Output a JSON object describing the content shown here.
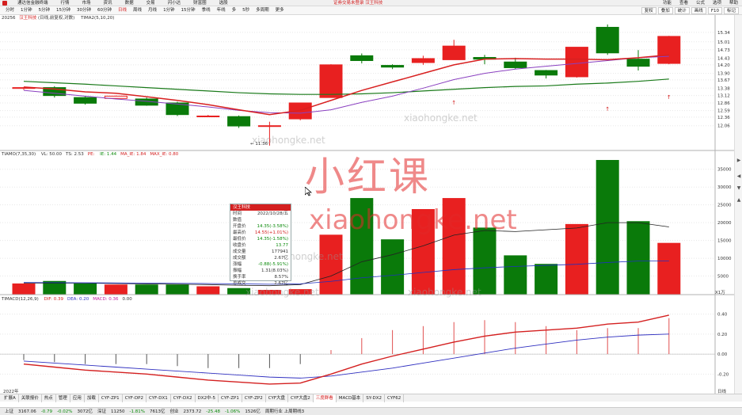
{
  "titlebar": {
    "menu": [
      "通达信金融终端",
      "行情",
      "市场",
      "资讯",
      "数据",
      "交易",
      "闪小达",
      "财富圈",
      "选股"
    ],
    "center": "证券交易未登录  汉王科技",
    "right": [
      "功能",
      "查看",
      "公式",
      "选项",
      "帮助"
    ]
  },
  "toolbar": {
    "periods": [
      "分时",
      "1分钟",
      "5分钟",
      "15分钟",
      "30分钟",
      "60分钟",
      "日线",
      "周线",
      "月线",
      "1分钟",
      "15分钟",
      "季线",
      "年线",
      "多",
      "5秒",
      "多周期",
      "更多"
    ],
    "active_period": "日线",
    "tools": [
      "复权",
      "叠加",
      "统计",
      "画线",
      "F10",
      "标记"
    ]
  },
  "kpanel": {
    "label_left": "20256",
    "label_stock": "汉王科技",
    "label_indicator": "(日线,前复权,对数)",
    "ma_label": "TIMA2(5,10,20)",
    "ylabels": [
      "15.01",
      "15.34",
      "14.73",
      "14.43",
      "14.20",
      "13.90",
      "13.67",
      "13.38",
      "13.12",
      "12.86",
      "12.59",
      "12.36",
      "12.06"
    ],
    "low_mark": "11.36"
  },
  "vpanel": {
    "label": "TIAMO(7,35,30)",
    "vars": [
      "VL: 50.00",
      "TS: 2.53",
      "PE: ",
      "IE: 1.44",
      "MA_IE: 1.84",
      "MAX_IE: 0.80"
    ],
    "ylabels": [
      "35000",
      "30000",
      "25000",
      "20000",
      "15000",
      "10000",
      "5000"
    ],
    "unit": "X1万"
  },
  "mpanel": {
    "label": "TIMACD(12,26,9)",
    "vars": [
      "DIF: 0.39",
      "DEA: 0.20",
      "MACD: 0.36",
      "0.00"
    ],
    "ylabels": [
      "0.40",
      "0.20",
      "0.00",
      "-0.20"
    ]
  },
  "tooltip": {
    "title": "汉王科技",
    "rows": [
      {
        "k": "时间",
        "v": "2022/10/28/五",
        "c": ""
      },
      {
        "k": "数值",
        "v": "",
        "c": ""
      },
      {
        "k": "开盘价",
        "v": "14.35(-3.58%)",
        "c": "dn"
      },
      {
        "k": "最高价",
        "v": "14.55(+1.01%)",
        "c": "up"
      },
      {
        "k": "最低价",
        "v": "14.35(-1.58%)",
        "c": "dn"
      },
      {
        "k": "收盘价",
        "v": "13.77",
        "c": "dn"
      },
      {
        "k": "成交量",
        "v": "177941",
        "c": ""
      },
      {
        "k": "成交额",
        "v": "2.67亿",
        "c": ""
      },
      {
        "k": "涨幅",
        "v": "-0.88(-5.91%)",
        "c": "dn"
      },
      {
        "k": "振幅",
        "v": "1.31(8.03%)",
        "c": ""
      },
      {
        "k": "换手率",
        "v": "8.57%",
        "c": ""
      },
      {
        "k": "总成交",
        "v": "2.67亿",
        "c": ""
      }
    ]
  },
  "watermark": {
    "cn": "小红课",
    "url": "xiaohongke.net"
  },
  "bottom_year": "2022年",
  "right_axis_label": "日线",
  "tabbar": {
    "tabs": [
      "扩展A",
      "关联报价",
      "热点",
      "管理",
      "应用",
      "加载",
      "CYF-ZP1",
      "CYF-DP2",
      "CYF-DX1",
      "CYF-DX2",
      "DX2中-5",
      "CYF-ZP1",
      "CYF-ZP2",
      "CYF大盘",
      "CYF大盘2",
      "三度群看",
      "MACD基本",
      "SY-DX2",
      "CYF62"
    ],
    "active": "三度群看"
  },
  "statusbar": {
    "items": [
      {
        "t": "上证",
        "c": ""
      },
      {
        "t": "3167.06",
        "c": ""
      },
      {
        "t": "-0.79",
        "c": "dn"
      },
      {
        "t": "-0.02%",
        "c": "dn"
      },
      {
        "t": "3072亿",
        "c": ""
      },
      {
        "t": "深证",
        "c": ""
      },
      {
        "t": "11250",
        "c": ""
      },
      {
        "t": "-1.81%",
        "c": "dn"
      },
      {
        "t": "7613亿",
        "c": ""
      },
      {
        "t": "创业",
        "c": ""
      },
      {
        "t": "2373.72",
        "c": ""
      },
      {
        "t": "-25.48",
        "c": "dn"
      },
      {
        "t": "-1.06%",
        "c": "dn"
      },
      {
        "t": "1526亿",
        "c": ""
      },
      {
        "t": "周期行业 上周期线3",
        "c": ""
      }
    ]
  },
  "chart_data": {
    "type": "candlestick",
    "candles": [
      {
        "o": 13.4,
        "c": 13.37,
        "h": 13.42,
        "l": 13.32,
        "dir": "up"
      },
      {
        "o": 13.4,
        "c": 13.12,
        "h": 13.45,
        "l": 13.05,
        "dir": "down"
      },
      {
        "o": 13.05,
        "c": 12.85,
        "h": 13.1,
        "l": 12.8,
        "dir": "down"
      },
      {
        "o": 13.02,
        "c": 13.1,
        "h": 13.12,
        "l": 13.0,
        "dir": "up"
      },
      {
        "o": 13.0,
        "c": 12.78,
        "h": 13.05,
        "l": 12.76,
        "dir": "down"
      },
      {
        "o": 12.86,
        "c": 12.45,
        "h": 12.9,
        "l": 12.4,
        "dir": "down"
      },
      {
        "o": 12.4,
        "c": 12.38,
        "h": 12.44,
        "l": 12.36,
        "dir": "up"
      },
      {
        "o": 12.38,
        "c": 12.05,
        "h": 12.42,
        "l": 11.98,
        "dir": "down"
      },
      {
        "o": 12.06,
        "c": 12.06,
        "h": 12.2,
        "l": 11.36,
        "dir": "up"
      },
      {
        "o": 12.3,
        "c": 12.86,
        "h": 12.86,
        "l": 12.25,
        "dir": "up"
      },
      {
        "o": 13.05,
        "c": 14.2,
        "h": 14.22,
        "l": 13.05,
        "dir": "up"
      },
      {
        "o": 14.52,
        "c": 14.35,
        "h": 14.6,
        "l": 14.25,
        "dir": "down"
      },
      {
        "o": 14.18,
        "c": 14.12,
        "h": 14.22,
        "l": 14.05,
        "dir": "down"
      },
      {
        "o": 14.28,
        "c": 14.42,
        "h": 14.52,
        "l": 14.2,
        "dir": "up"
      },
      {
        "o": 14.38,
        "c": 14.86,
        "h": 15.08,
        "l": 14.38,
        "dir": "up"
      },
      {
        "o": 14.46,
        "c": 14.4,
        "h": 14.55,
        "l": 14.22,
        "dir": "down"
      },
      {
        "o": 14.3,
        "c": 14.1,
        "h": 14.45,
        "l": 14.05,
        "dir": "down"
      },
      {
        "o": 14.0,
        "c": 13.84,
        "h": 14.02,
        "l": 13.72,
        "dir": "down"
      },
      {
        "o": 13.78,
        "c": 14.82,
        "h": 14.82,
        "l": 13.75,
        "dir": "up"
      },
      {
        "o": 15.52,
        "c": 14.62,
        "h": 15.62,
        "l": 14.55,
        "dir": "down"
      },
      {
        "o": 14.4,
        "c": 14.15,
        "h": 14.72,
        "l": 14.0,
        "dir": "down"
      },
      {
        "o": 14.25,
        "c": 15.2,
        "h": 15.22,
        "l": 14.22,
        "dir": "up"
      }
    ],
    "ma_red": [
      13.42,
      13.35,
      13.25,
      13.2,
      13.08,
      12.95,
      12.8,
      12.62,
      12.45,
      12.6,
      12.95,
      13.3,
      13.6,
      13.9,
      14.2,
      14.4,
      14.42,
      14.4,
      14.4,
      14.38,
      14.45,
      14.55
    ],
    "ma_purple": [
      13.3,
      13.2,
      13.1,
      13.0,
      12.92,
      12.82,
      12.72,
      12.6,
      12.52,
      12.5,
      12.62,
      12.88,
      13.1,
      13.38,
      13.68,
      13.9,
      14.05,
      14.15,
      14.25,
      14.35,
      14.45,
      14.5
    ],
    "ma_green": [
      13.62,
      13.57,
      13.52,
      13.46,
      13.4,
      13.34,
      13.28,
      13.22,
      13.18,
      13.16,
      13.16,
      13.18,
      13.22,
      13.28,
      13.34,
      13.4,
      13.44,
      13.46,
      13.52,
      13.56,
      13.62,
      13.7
    ],
    "volume": [
      2800,
      3500,
      2800,
      2500,
      2500,
      2500,
      2000,
      1500,
      1000,
      1200,
      16500,
      26800,
      15200,
      23700,
      26800,
      18500,
      10700,
      8300,
      19500,
      37500,
      20300,
      14200
    ],
    "vol_ma_black": [
      3000,
      3000,
      3000,
      2900,
      2800,
      2700,
      2600,
      2400,
      2300,
      2600,
      5000,
      9000,
      11000,
      13500,
      16500,
      17800,
      17500,
      18000,
      18500,
      20000,
      20000,
      18800
    ],
    "vol_ma_blue": [
      3200,
      3150,
      3100,
      3050,
      3000,
      2950,
      2900,
      2800,
      2700,
      2800,
      3500,
      4500,
      5200,
      6000,
      6800,
      7300,
      7700,
      8000,
      8300,
      8800,
      9200,
      9200
    ],
    "dif": [
      -0.1,
      -0.13,
      -0.16,
      -0.18,
      -0.2,
      -0.23,
      -0.26,
      -0.28,
      -0.3,
      -0.29,
      -0.2,
      -0.1,
      -0.02,
      0.05,
      0.12,
      0.18,
      0.22,
      0.24,
      0.26,
      0.3,
      0.32,
      0.39
    ],
    "dea": [
      -0.07,
      -0.09,
      -0.11,
      -0.13,
      -0.15,
      -0.17,
      -0.19,
      -0.21,
      -0.23,
      -0.24,
      -0.22,
      -0.18,
      -0.14,
      -0.09,
      -0.04,
      0.01,
      0.06,
      0.1,
      0.14,
      0.17,
      0.19,
      0.2
    ],
    "macd_bars": [
      -0.06,
      -0.08,
      -0.1,
      -0.1,
      -0.1,
      -0.12,
      -0.14,
      -0.14,
      -0.14,
      -0.1,
      0.04,
      0.16,
      0.24,
      0.28,
      0.32,
      0.34,
      0.32,
      0.28,
      0.24,
      0.26,
      0.26,
      0.36
    ]
  }
}
